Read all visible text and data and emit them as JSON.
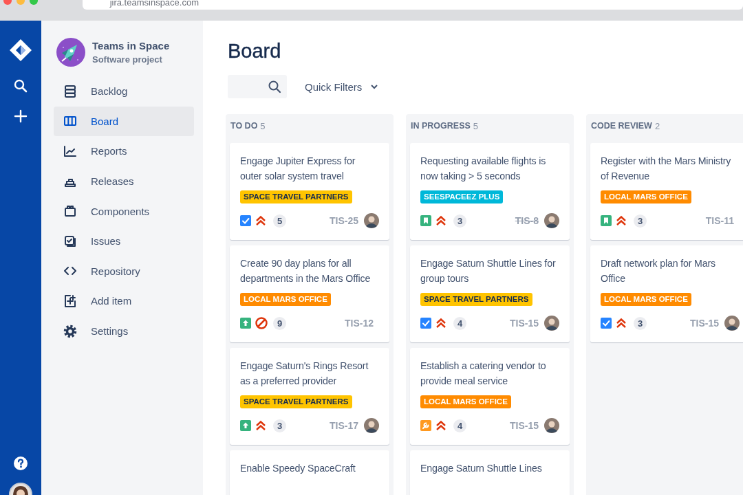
{
  "browser": {
    "address": "jira.teamsinspace.com"
  },
  "project": {
    "name": "Teams in Space",
    "type": "Software project"
  },
  "sidebar": {
    "items": [
      {
        "label": "Backlog",
        "kind": "backlog",
        "selected": false
      },
      {
        "label": "Board",
        "kind": "board",
        "selected": true
      },
      {
        "label": "Reports",
        "kind": "reports",
        "selected": false
      },
      {
        "label": "Releases",
        "kind": "releases",
        "selected": false
      },
      {
        "label": "Components",
        "kind": "components",
        "selected": false
      },
      {
        "label": "Issues",
        "kind": "issues",
        "selected": false
      },
      {
        "label": "Repository",
        "kind": "repository",
        "selected": false
      },
      {
        "label": "Add item",
        "kind": "add",
        "selected": false
      },
      {
        "label": "Settings",
        "kind": "settings",
        "selected": false
      }
    ]
  },
  "page_title": "Board",
  "quick_filters": {
    "label": "Quick Filters"
  },
  "columns": [
    {
      "name": "TO DO",
      "count": "5",
      "cards": [
        {
          "title": "Engage Jupiter Express for outer solar system travel",
          "epic": {
            "label": "SPACE TRAVEL PARTNERS",
            "color": "#ffc400"
          },
          "icons": [
            {
              "kind": "task"
            },
            {
              "kind": "highest"
            }
          ],
          "comments": "5",
          "key": "TIS-25",
          "done": false,
          "avatar": true
        },
        {
          "title": "Create 90 day plans for all departments in the Mars Office",
          "epic": {
            "label": "LOCAL MARS OFFICE",
            "color": "#ff8b00"
          },
          "icons": [
            {
              "kind": "improvement"
            },
            {
              "kind": "blocker"
            }
          ],
          "comments": "9",
          "key": "TIS-12",
          "done": false,
          "avatar": false
        },
        {
          "title": "Engage Saturn's Rings Resort as a preferred provider",
          "epic": {
            "label": "SPACE TRAVEL PARTNERS",
            "color": "#ffc400"
          },
          "icons": [
            {
              "kind": "improvement"
            },
            {
              "kind": "highest"
            }
          ],
          "comments": "3",
          "key": "TIS-17",
          "done": false,
          "avatar": true
        },
        {
          "title": "Enable Speedy SpaceCraft"
        }
      ]
    },
    {
      "name": "IN PROGRESS",
      "count": "5",
      "cards": [
        {
          "title": "Requesting available flights is now taking > 5 seconds",
          "epic": {
            "label": "SEESPACEEZ PLUS",
            "color": "#00b8d9"
          },
          "icons": [
            {
              "kind": "story"
            },
            {
              "kind": "highest"
            }
          ],
          "comments": "3",
          "key": "TIS-8",
          "done": true,
          "avatar": true
        },
        {
          "title": "Engage Saturn Shuttle Lines for group tours",
          "epic": {
            "label": "SPACE TRAVEL PARTNERS",
            "color": "#ffc400"
          },
          "icons": [
            {
              "kind": "task"
            },
            {
              "kind": "highest"
            }
          ],
          "comments": "4",
          "key": "TIS-15",
          "done": false,
          "avatar": true
        },
        {
          "title": "Establish a catering vendor to provide meal service",
          "epic": {
            "label": "LOCAL MARS OFFICE",
            "color": "#ff8b00"
          },
          "icons": [
            {
              "kind": "subtask"
            },
            {
              "kind": "highest"
            }
          ],
          "comments": "4",
          "key": "TIS-15",
          "done": false,
          "avatar": true
        },
        {
          "title": "Engage Saturn Shuttle Lines"
        }
      ]
    },
    {
      "name": "CODE REVIEW",
      "count": "2",
      "cards": [
        {
          "title": "Register with the Mars Ministry of Revenue",
          "epic": {
            "label": "LOCAL MARS OFFICE",
            "color": "#ff8b00"
          },
          "icons": [
            {
              "kind": "story"
            },
            {
              "kind": "highest"
            }
          ],
          "comments": "3",
          "key": "TIS-11",
          "done": false,
          "avatar": false
        },
        {
          "title": "Draft network plan for Mars Office",
          "epic": {
            "label": "LOCAL MARS OFFICE",
            "color": "#ff8b00"
          },
          "icons": [
            {
              "kind": "task"
            },
            {
              "kind": "highest"
            }
          ],
          "comments": "3",
          "key": "TIS-15",
          "done": false,
          "avatar": true
        }
      ]
    }
  ]
}
